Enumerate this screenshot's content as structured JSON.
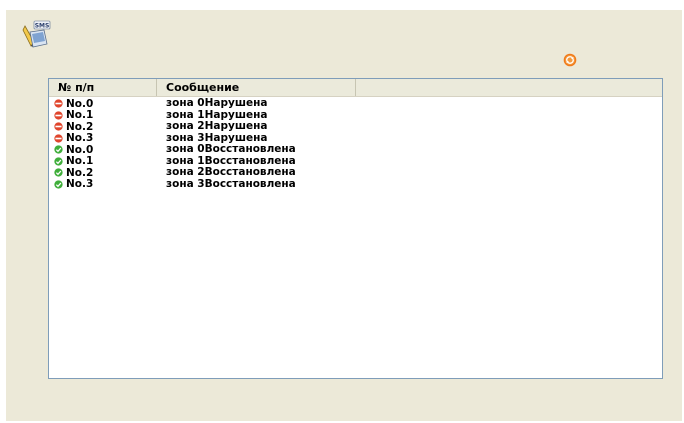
{
  "list": {
    "columns": [
      "№ п/п",
      "Сообщение",
      ""
    ],
    "rows": [
      {
        "num": "No.0",
        "message": "зона 0Нарушена",
        "status": "alarm"
      },
      {
        "num": "No.1",
        "message": "зона 1Нарушена",
        "status": "alarm"
      },
      {
        "num": "No.2",
        "message": "зона 2Нарушена",
        "status": "alarm"
      },
      {
        "num": "No.3",
        "message": "зона 3Нарушена",
        "status": "alarm"
      },
      {
        "num": "No.0",
        "message": "зона 0Восстановлена",
        "status": "ok"
      },
      {
        "num": "No.1",
        "message": "зона 1Восстановлена",
        "status": "ok"
      },
      {
        "num": "No.2",
        "message": "зона 2Восстановлена",
        "status": "ok"
      },
      {
        "num": "No.3",
        "message": "зона 3Восстановлена",
        "status": "ok"
      }
    ]
  },
  "icons": {
    "app": "sms-icon",
    "refresh": "refresh-icon",
    "alarm": "alarm-status-icon",
    "ok": "ok-status-icon"
  },
  "colors": {
    "alarm": "#e0452c",
    "ok": "#3fae3a",
    "refresh": "#f07a1a"
  }
}
